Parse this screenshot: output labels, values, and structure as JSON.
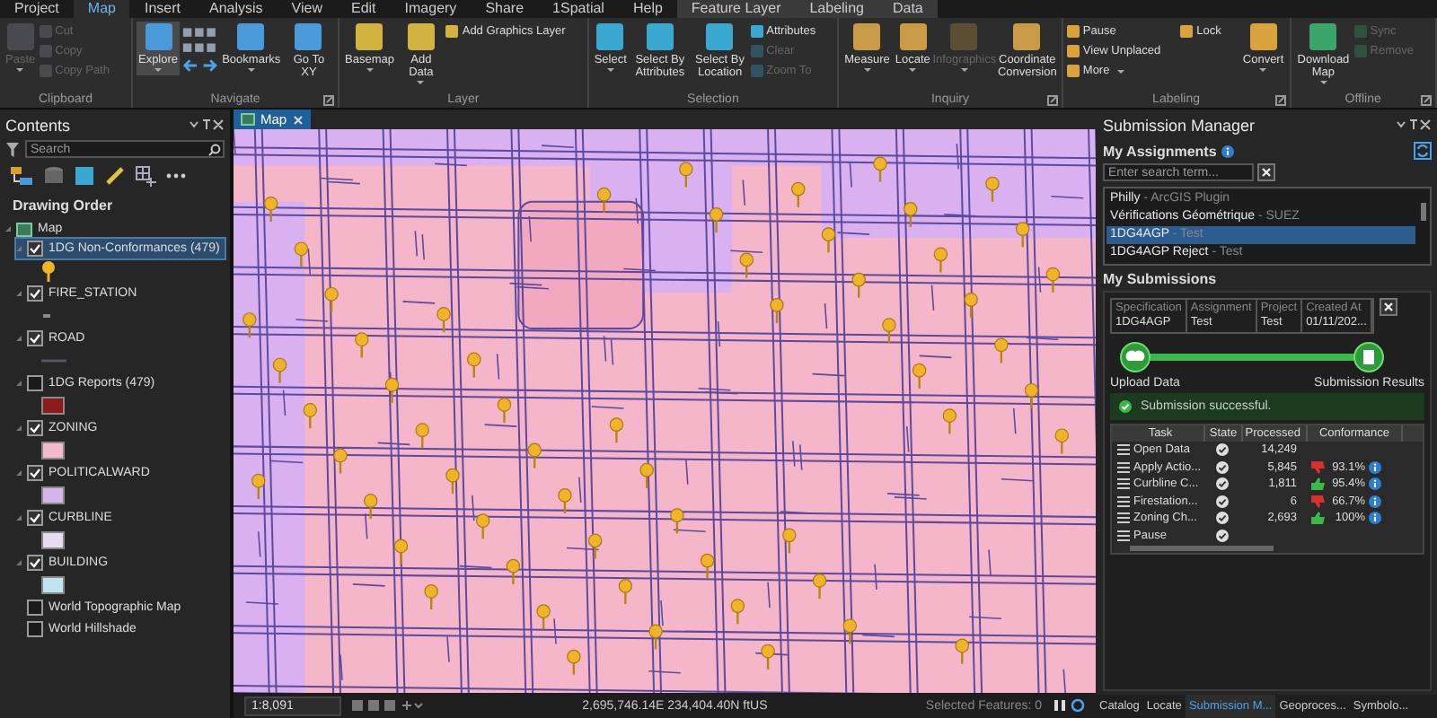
{
  "ribbon_tabs": [
    {
      "label": "Project",
      "selected": false
    },
    {
      "label": "Map",
      "selected": true
    },
    {
      "label": "Insert",
      "selected": false
    },
    {
      "label": "Analysis",
      "selected": false
    },
    {
      "label": "View",
      "selected": false
    },
    {
      "label": "Edit",
      "selected": false
    },
    {
      "label": "Imagery",
      "selected": false
    },
    {
      "label": "Share",
      "selected": false
    },
    {
      "label": "1Spatial",
      "selected": false
    },
    {
      "label": "Help",
      "selected": false
    }
  ],
  "contextual_tabs": [
    {
      "label": "Feature Layer",
      "selected": false
    },
    {
      "label": "Labeling",
      "selected": false
    },
    {
      "label": "Data",
      "selected": false
    }
  ],
  "ribbon_groups": [
    {
      "label": "Clipboard",
      "launcher": false,
      "tools": [
        {
          "label": "Paste",
          "kind": "large",
          "disabled": true,
          "selected": false,
          "dropdown": true
        },
        {
          "label": "Cut",
          "kind": "small",
          "disabled": true,
          "selected": false
        },
        {
          "label": "Copy",
          "kind": "small",
          "disabled": true,
          "selected": false
        },
        {
          "label": "Copy Path",
          "kind": "small",
          "disabled": true,
          "selected": false
        }
      ]
    },
    {
      "label": "Navigate",
      "launcher": true,
      "tools": [
        {
          "label": "Explore",
          "kind": "large",
          "disabled": false,
          "selected": true,
          "dropdown": true
        },
        {
          "kind": "arrows"
        },
        {
          "label": "Bookmarks",
          "kind": "large",
          "disabled": false,
          "selected": false,
          "dropdown": true
        },
        {
          "label": "Go To XY",
          "kind": "large",
          "disabled": false,
          "selected": false
        }
      ]
    },
    {
      "label": "Layer",
      "launcher": false,
      "tools": [
        {
          "label": "Basemap",
          "kind": "large",
          "disabled": false,
          "selected": false,
          "dropdown": true
        },
        {
          "label": "Add Data",
          "kind": "large",
          "disabled": false,
          "selected": false,
          "dropdown": true
        },
        {
          "label": "Add Graphics Layer",
          "kind": "small",
          "disabled": false,
          "selected": false
        }
      ]
    },
    {
      "label": "Selection",
      "launcher": false,
      "tools": [
        {
          "label": "Select",
          "kind": "large",
          "disabled": false,
          "selected": false,
          "dropdown": true
        },
        {
          "label": "Select By Attributes",
          "kind": "large",
          "disabled": false,
          "selected": false
        },
        {
          "label": "Select By Location",
          "kind": "large",
          "disabled": false,
          "selected": false
        },
        {
          "label": "Attributes",
          "kind": "small",
          "disabled": false,
          "selected": false
        },
        {
          "label": "Clear",
          "kind": "small",
          "disabled": true,
          "selected": false
        },
        {
          "label": "Zoom To",
          "kind": "small",
          "disabled": true,
          "selected": false
        }
      ]
    },
    {
      "label": "Inquiry",
      "launcher": true,
      "tools": [
        {
          "label": "Measure",
          "kind": "large",
          "disabled": false,
          "selected": false,
          "dropdown": true
        },
        {
          "label": "Locate",
          "kind": "large",
          "disabled": false,
          "selected": false,
          "dropdown": true
        },
        {
          "label": "Infographics",
          "kind": "large",
          "disabled": true,
          "selected": false,
          "dropdown": true
        },
        {
          "label": "Coordinate Conversion",
          "kind": "large",
          "disabled": false,
          "selected": false
        }
      ]
    },
    {
      "label": "Labeling",
      "launcher": true,
      "tools": [
        {
          "label": "Pause",
          "kind": "small",
          "disabled": false,
          "selected": false
        },
        {
          "label": "View Unplaced",
          "kind": "small",
          "disabled": false,
          "selected": false
        },
        {
          "label": "More",
          "kind": "small",
          "disabled": false,
          "selected": false,
          "dropdown": true
        },
        {
          "label": "Lock",
          "kind": "small",
          "disabled": false,
          "selected": false
        },
        {
          "label": "Convert",
          "kind": "large",
          "disabled": false,
          "selected": false,
          "dropdown": true
        }
      ]
    },
    {
      "label": "Offline",
      "launcher": true,
      "tools": [
        {
          "label": "Download Map",
          "kind": "large",
          "disabled": false,
          "selected": false,
          "dropdown": true
        },
        {
          "label": "Sync",
          "kind": "small",
          "disabled": true,
          "selected": false
        },
        {
          "label": "Remove",
          "kind": "small",
          "disabled": true,
          "selected": false
        }
      ]
    }
  ],
  "contents": {
    "title": "Contents",
    "search": {
      "placeholder": "Search"
    },
    "heading": "Drawing Order",
    "map": {
      "label": "Map",
      "expanded": true,
      "children": [
        {
          "label": "1DG Non-Conformances (479)",
          "checked": true,
          "selected": true,
          "expanded": true,
          "symbol": {
            "kind": "pin"
          }
        },
        {
          "label": "FIRE_STATION",
          "checked": true,
          "selected": false,
          "expanded": true,
          "symbol": {
            "kind": "point"
          }
        },
        {
          "label": "ROAD",
          "checked": true,
          "selected": false,
          "expanded": true,
          "symbol": {
            "kind": "line"
          }
        },
        {
          "label": "1DG Reports (479)",
          "checked": false,
          "selected": false,
          "expanded": true,
          "symbol": {
            "kind": "fill",
            "color": "#8b1a1a"
          }
        },
        {
          "label": "ZONING",
          "checked": true,
          "selected": false,
          "expanded": true,
          "symbol": {
            "kind": "fill",
            "color": "#f5b8cc"
          }
        },
        {
          "label": "POLITICALWARD",
          "checked": true,
          "selected": false,
          "expanded": true,
          "symbol": {
            "kind": "fill",
            "color": "#d8b4ee"
          }
        },
        {
          "label": "CURBLINE",
          "checked": true,
          "selected": false,
          "expanded": true,
          "symbol": {
            "kind": "fill",
            "color": "#e8dcf2"
          }
        },
        {
          "label": "BUILDING",
          "checked": true,
          "selected": false,
          "expanded": true,
          "symbol": {
            "kind": "fill",
            "color": "#c2e4f0"
          }
        },
        {
          "label": "World Topographic Map",
          "checked": false,
          "selected": false
        },
        {
          "label": "World Hillshade",
          "checked": false,
          "selected": false
        }
      ]
    }
  },
  "map_view": {
    "tab": {
      "label": "Map",
      "selected": true
    }
  },
  "status_bar": {
    "scale": "1:8,091",
    "coordinates": "2,695,746.14E 234,404.40N ftUS",
    "selected_features": "Selected Features: 0"
  },
  "submission_manager": {
    "title": "Submission Manager",
    "assignments": {
      "heading": "My Assignments",
      "search": {
        "placeholder": "Enter search term..."
      },
      "items": [
        {
          "name": "Philly",
          "detail": "- ArcGIS Plugin",
          "selected": false
        },
        {
          "name": "Vérifications Géométrique",
          "detail": "- SUEZ",
          "selected": false
        },
        {
          "name": "1DG4AGP",
          "detail": "- Test",
          "selected": true
        },
        {
          "name": "1DG4AGP Reject",
          "detail": "- Test",
          "selected": false
        }
      ]
    },
    "submissions": {
      "heading": "My Submissions",
      "fields": [
        {
          "label": "Specification",
          "value": "1DG4AGP"
        },
        {
          "label": "Assignment",
          "value": "Test"
        },
        {
          "label": "Project",
          "value": "Test"
        },
        {
          "label": "Created At",
          "value": "01/11/202..."
        }
      ],
      "steps": [
        "Upload Data",
        "Submission Results"
      ],
      "message": "Submission successful.",
      "task_columns": [
        "Task",
        "State",
        "Processed",
        "Conformance"
      ],
      "tasks": [
        {
          "task": "Open Data",
          "processed": "14,249"
        },
        {
          "task": "Apply Actio...",
          "processed": "5,845",
          "passed": false,
          "conformance": "93.1%"
        },
        {
          "task": "Curbline C...",
          "processed": "1,811",
          "passed": true,
          "conformance": "95.4%"
        },
        {
          "task": "Firestation...",
          "processed": "6",
          "passed": false,
          "conformance": "66.7%"
        },
        {
          "task": "Zoning Ch...",
          "processed": "2,693",
          "passed": true,
          "conformance": "100%"
        },
        {
          "task": "Pause"
        }
      ]
    }
  },
  "dock_tabs": [
    {
      "label": "Catalog",
      "selected": false
    },
    {
      "label": "Locate",
      "selected": false
    },
    {
      "label": "Submission M...",
      "selected": true
    },
    {
      "label": "Geoproces...",
      "selected": false
    },
    {
      "label": "Symbolo...",
      "selected": false
    }
  ]
}
